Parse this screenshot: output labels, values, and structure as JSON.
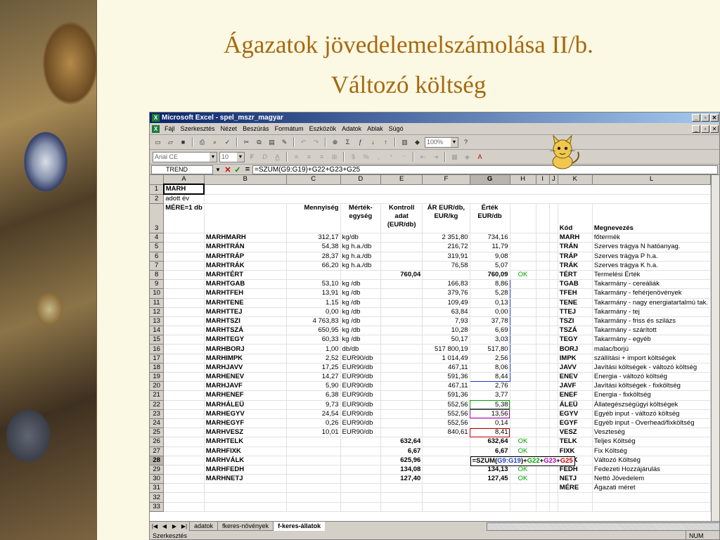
{
  "slide": {
    "title_line1": "Ágazatok jövedelemelszámolása II/b.",
    "title_line2": "Változó költség"
  },
  "window": {
    "title": "Microsoft Excel - spel_mszr_magyar",
    "min": "_",
    "max": "▫",
    "close": "✕"
  },
  "menu": [
    "Fájl",
    "Szerkesztés",
    "Nézet",
    "Beszúrás",
    "Formátum",
    "Eszközök",
    "Adatok",
    "Ablak",
    "Súgó"
  ],
  "toolbar": {
    "zoom": "100%",
    "font_name": "Arial CE",
    "font_size": "10"
  },
  "formula_bar": {
    "name_box": "TREND",
    "formula": "=SZUM(G9:G19)+G22+G23+G25"
  },
  "columns": [
    "A",
    "B",
    "C",
    "D",
    "E",
    "F",
    "G",
    "H",
    "I",
    "J",
    "K",
    "L"
  ],
  "header_cells": {
    "a1": "MARH",
    "a2": "adott év",
    "a3": "MÉRE=1 db",
    "mennyiseg": "Mennyiség",
    "mertek": "Mérték-egység",
    "kontroll": "Kontroll adat (EUR/db)",
    "ar": "ÁR EUR/db, EUR/kg",
    "ertek": "Érték EUR/db",
    "kod": "Kód",
    "megnevezes": "Megnevezés"
  },
  "rows": [
    {
      "n": "4",
      "b": "MARHMARH",
      "c": "312,17",
      "d": "kg/db",
      "e": "",
      "f": "2 351,80",
      "g": "734,16",
      "h": "",
      "k": "MARH",
      "l": "főtermék"
    },
    {
      "n": "5",
      "b": "MARHTRÁN",
      "c": "54,38",
      "d": "kg h.a./db",
      "e": "",
      "f": "216,72",
      "g": "11,79",
      "h": "",
      "k": "TRÁN",
      "l": "Szerves trágya N hatóanyag."
    },
    {
      "n": "6",
      "b": "MARHTRÁP",
      "c": "28,37",
      "d": "kg h.a./db",
      "e": "",
      "f": "319,91",
      "g": "9,08",
      "h": "",
      "k": "TRÁP",
      "l": "Szerves trágya P h.a."
    },
    {
      "n": "7",
      "b": "MARHTRÁK",
      "c": "66,20",
      "d": "kg h.a./db",
      "e": "",
      "f": "76,58",
      "g": "5,07",
      "h": "",
      "k": "TRÁK",
      "l": "Szerves trágya K h.a."
    },
    {
      "n": "8",
      "b": "MARHTÉRT",
      "c": "",
      "d": "",
      "e": "760,04",
      "f": "",
      "g": "760,09",
      "h": "OK",
      "k": "TÉRT",
      "l": "Termelési Érték"
    },
    {
      "n": "9",
      "b": "MARHTGAB",
      "c": "53,10",
      "d": "kg /db",
      "e": "",
      "f": "166,83",
      "g": "8,86",
      "h": "",
      "k": "TGAB",
      "l": "Takarmány - cereáliák"
    },
    {
      "n": "10",
      "b": "MARHTFEH",
      "c": "13,91",
      "d": "kg /db",
      "e": "",
      "f": "379,76",
      "g": "5,28",
      "h": "",
      "k": "TFEH",
      "l": "Takarmány - fehérjenövények"
    },
    {
      "n": "11",
      "b": "MARHTENE",
      "c": "1,15",
      "d": "kg /db",
      "e": "",
      "f": "109,49",
      "g": "0,13",
      "h": "",
      "k": "TENE",
      "l": "Takarmány - nagy energiatartalmú tak."
    },
    {
      "n": "12",
      "b": "MARHTTEJ",
      "c": "0,00",
      "d": "kg /db",
      "e": "",
      "f": "63,84",
      "g": "0,00",
      "h": "",
      "k": "TTEJ",
      "l": "Takarmány - tej"
    },
    {
      "n": "13",
      "b": "MARHTSZI",
      "c": "4 763,83",
      "d": "kg /db",
      "e": "",
      "f": "7,93",
      "g": "37,78",
      "h": "",
      "k": "TSZI",
      "l": "Takarmány - friss és szilázs"
    },
    {
      "n": "14",
      "b": "MARHTSZÁ",
      "c": "650,95",
      "d": "kg /db",
      "e": "",
      "f": "10,28",
      "g": "6,69",
      "h": "",
      "k": "TSZÁ",
      "l": "Takarmány - szárított"
    },
    {
      "n": "15",
      "b": "MARHTEGY",
      "c": "60,33",
      "d": "kg /db",
      "e": "",
      "f": "50,17",
      "g": "3,03",
      "h": "",
      "k": "TEGY",
      "l": "Takarmány - egyéb"
    },
    {
      "n": "16",
      "b": "MARHBORJ",
      "c": "1,00",
      "d": "db/db",
      "e": "",
      "f": "517 800,19",
      "g": "517,80",
      "h": "",
      "k": "BORJ",
      "l": "malac/borjú"
    },
    {
      "n": "17",
      "b": "MARHIMPK",
      "c": "2,52",
      "d": "EUR90/db",
      "e": "",
      "f": "1 014,49",
      "g": "2,56",
      "h": "",
      "k": "IMPK",
      "l": "szállítási + import költségek"
    },
    {
      "n": "18",
      "b": "MARHJAVV",
      "c": "17,25",
      "d": "EUR90/db",
      "e": "",
      "f": "467,11",
      "g": "8,06",
      "h": "",
      "k": "JAVV",
      "l": "Javítási költségek - változó költség"
    },
    {
      "n": "19",
      "b": "MARHENEV",
      "c": "14,27",
      "d": "EUR90/db",
      "e": "",
      "f": "591,36",
      "g": "8,44",
      "h": "",
      "k": "ENEV",
      "l": "Energia - változó költség"
    },
    {
      "n": "20",
      "b": "MARHJAVF",
      "c": "5,90",
      "d": "EUR90/db",
      "e": "",
      "f": "467,11",
      "g": "2,76",
      "h": "",
      "k": "JAVF",
      "l": "Javítási költségek - fixköltség"
    },
    {
      "n": "21",
      "b": "MARHENEF",
      "c": "6,38",
      "d": "EUR90/db",
      "e": "",
      "f": "591,36",
      "g": "3,77",
      "h": "",
      "k": "ENEF",
      "l": "Energia - fixköltség"
    },
    {
      "n": "22",
      "b": "MARHÁLEÜ",
      "c": "9,73",
      "d": "EUR90/db",
      "e": "",
      "f": "552,56",
      "g": "5,38",
      "h": "",
      "k": "ÁLEÜ",
      "l": "Állategészségügyi költségek"
    },
    {
      "n": "23",
      "b": "MARHEGYV",
      "c": "24,54",
      "d": "EUR90/db",
      "e": "",
      "f": "552,56",
      "g": "13,56",
      "h": "",
      "k": "EGYV",
      "l": "Egyéb input - változó költség"
    },
    {
      "n": "24",
      "b": "MARHEGYF",
      "c": "0,26",
      "d": "EUR90/db",
      "e": "",
      "f": "552,56",
      "g": "0,14",
      "h": "",
      "k": "EGYF",
      "l": "Egyéb input - Overhead/fixköltség"
    },
    {
      "n": "25",
      "b": "MARHVESZ",
      "c": "10,01",
      "d": "EUR90/db",
      "e": "",
      "f": "840,61",
      "g": "8,41",
      "h": "",
      "k": "VESZ",
      "l": "Veszteség"
    },
    {
      "n": "26",
      "b": "MARHTELK",
      "c": "",
      "d": "",
      "e": "632,64",
      "f": "",
      "g": "632,64",
      "h": "OK",
      "k": "TELK",
      "l": "Teljes Költség"
    },
    {
      "n": "27",
      "b": "MARHFIXK",
      "c": "",
      "d": "",
      "e": "6,67",
      "f": "",
      "g": "6,67",
      "h": "OK",
      "k": "FIXK",
      "l": "Fix Költség"
    },
    {
      "n": "28",
      "b": "MARHVÁLK",
      "c": "",
      "d": "",
      "e": "625,96",
      "f": "",
      "g": "",
      "h": "",
      "k": "VÁLK",
      "l": "Változó Költség"
    },
    {
      "n": "29",
      "b": "MARHFEDH",
      "c": "",
      "d": "",
      "e": "134,08",
      "f": "",
      "g": "134,13",
      "h": "OK",
      "k": "FEDH",
      "l": "Fedezeti Hozzájárulás"
    },
    {
      "n": "30",
      "b": "MARHNETJ",
      "c": "",
      "d": "",
      "e": "127,40",
      "f": "",
      "g": "127,45",
      "h": "OK",
      "k": "NETJ",
      "l": "Nettó Jövedelem"
    },
    {
      "n": "31",
      "b": "",
      "c": "",
      "d": "",
      "e": "",
      "f": "",
      "g": "",
      "h": "",
      "k": "MÉRE",
      "l": "Ágazati méret"
    },
    {
      "n": "32",
      "b": "",
      "c": "",
      "d": "",
      "e": "",
      "f": "",
      "g": "",
      "h": "",
      "k": "",
      "l": ""
    },
    {
      "n": "33",
      "b": "",
      "c": "",
      "d": "",
      "e": "",
      "f": "",
      "g": "",
      "h": "",
      "k": "",
      "l": ""
    }
  ],
  "edit_formula": {
    "p1": "=SZUM(",
    "range": "G9:G19",
    "p2": ")+",
    "g22": "G22",
    "plus1": "+",
    "g23": "G23",
    "plus2": "+",
    "g25": "G25"
  },
  "colors": {
    "range": "#1f3fc8",
    "g22": "#00a000",
    "g23": "#b000b0",
    "g25": "#c00000",
    "ok": "#00a000"
  },
  "sheets": [
    "adatok",
    "fkeres-növények",
    "f-keres-állatok"
  ],
  "status": {
    "mode": "Szerkesztés",
    "num": "NUM"
  }
}
